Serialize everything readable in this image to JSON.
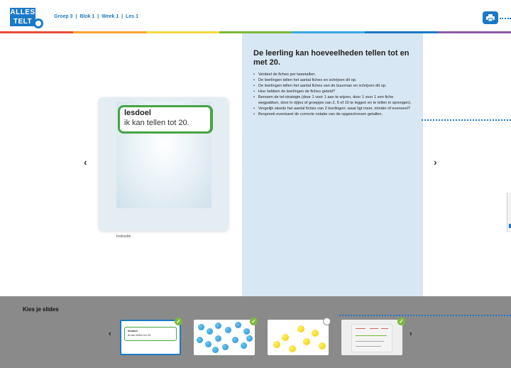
{
  "app": {
    "logo_top": "ALLES",
    "logo_bottom": "TELT",
    "logo_suffix": "Q"
  },
  "breadcrumb": {
    "items": [
      "Groep 3",
      "Blok 1",
      "Week 1",
      "Les 1"
    ],
    "separator": "|"
  },
  "toolbar": {
    "print_icon": "printer-icon"
  },
  "colors": {
    "accent": "#1b78c7",
    "panel": "#d8e7f4",
    "lesdoel_border": "#47a447",
    "check": "#7cb83a",
    "rainbow": [
      "#e94b3c",
      "#f7a233",
      "#f5d93a",
      "#7cb83a",
      "#36a9e1",
      "#1b78c7",
      "#8e5aa8"
    ]
  },
  "main": {
    "prev_label": "‹",
    "next_label": "›",
    "slide": {
      "title": "lesdoel",
      "text": "ik kan tellen tot 20.",
      "caption": "Instructie"
    },
    "info": {
      "title": "De leerling kan hoeveelheden tellen tot en met 20.",
      "items": [
        "Verdeel de fiches per tweetallen.",
        "De leerlingen tellen het aantal fiches en schrijven dit op.",
        "De leerlingen tellen het aantal fiches van de buurman en schrijven dit op.",
        "Hoe hebben de leerlingen de fiches geteld?",
        "Benoem de tel-strategie (door 1 voor 1 aan te wijzen, door 1 voor 1 een fiche wegpakken, door in rijtjes of groepjes van 2, 5 of 10 te leggen en te tellen in sprongen).",
        "Vergelijk steeds het aantal fiches van 2 leerlingen: waar ligt meer, minder of evenveel?",
        "Bespreek eventueel de correcte notatie van de opgeschreven getallen."
      ]
    }
  },
  "picker": {
    "title": "Kies je slides",
    "prev_label": "‹",
    "next_label": "›",
    "thumbs": [
      {
        "kind": "lesdoel",
        "t1": "lesdoel",
        "t2": "ik kan tellen tot 20.",
        "checked": true
      },
      {
        "kind": "blue-dots",
        "checked": true
      },
      {
        "kind": "yellow-dots",
        "checked": false
      },
      {
        "kind": "worksheet",
        "checked": true
      }
    ],
    "check_mark": "✓"
  }
}
